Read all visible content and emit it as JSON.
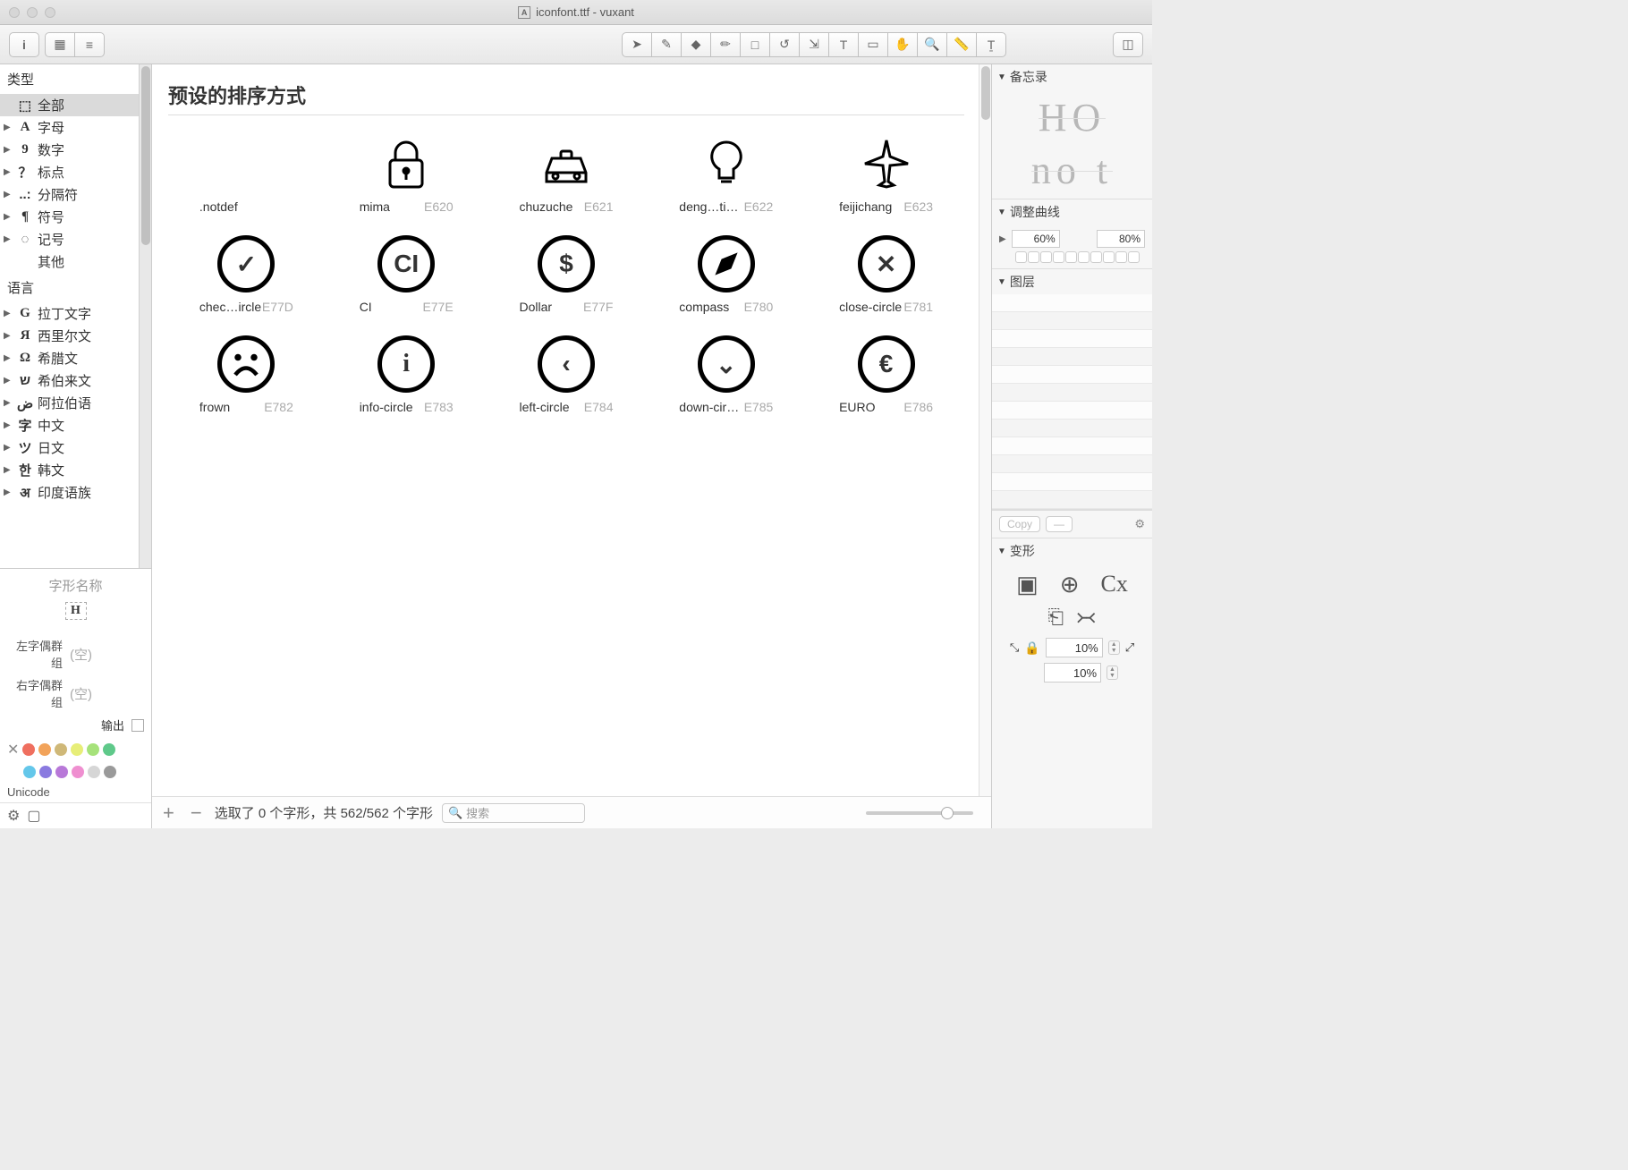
{
  "window": {
    "title": "iconfont.ttf - vuxant"
  },
  "sidebar": {
    "section_types": "类型",
    "types": [
      {
        "glyph": "⬚",
        "label": "全部",
        "selected": true,
        "arrow": false
      },
      {
        "glyph": "A",
        "label": "字母",
        "arrow": true,
        "serif": true
      },
      {
        "glyph": "9",
        "label": "数字",
        "arrow": true,
        "serif": true,
        "bold": true
      },
      {
        "glyph": "？",
        "label": "标点",
        "arrow": true
      },
      {
        "glyph": "..:",
        "label": "分隔符",
        "arrow": true
      },
      {
        "glyph": "¶",
        "label": "符号",
        "arrow": true,
        "serif": true
      },
      {
        "glyph": "◌",
        "label": "记号",
        "arrow": true
      },
      {
        "glyph": "",
        "label": "其他",
        "arrow": false
      }
    ],
    "section_lang": "语言",
    "langs": [
      {
        "glyph": "G",
        "label": "拉丁文字",
        "serif": true
      },
      {
        "glyph": "Я",
        "label": "西里尔文",
        "serif": true
      },
      {
        "glyph": "Ω",
        "label": "希腊文",
        "serif": true
      },
      {
        "glyph": "ש",
        "label": "希伯来文"
      },
      {
        "glyph": "ض",
        "label": "阿拉伯语"
      },
      {
        "glyph": "字",
        "label": "中文",
        "bold": true
      },
      {
        "glyph": "ツ",
        "label": "日文",
        "bold": true
      },
      {
        "glyph": "한",
        "label": "韩文",
        "bold": true
      },
      {
        "glyph": "अ",
        "label": "印度语族"
      }
    ],
    "glyph_name_label": "字形名称",
    "left_kern_label": "左字偶群组",
    "right_kern_label": "右字偶群组",
    "empty": "(空)",
    "output_label": "输出",
    "unicode_label": "Unicode",
    "colors_a": [
      "#ef6f5f",
      "#f2a35a",
      "#cfb878",
      "#e7ee78",
      "#a6e27a",
      "#5fc98a"
    ],
    "colors_b": [
      "#64c7ea",
      "#8a7ae0",
      "#b878d8",
      "#ef8fd0",
      "#d6d6d6",
      "#9a9a9a"
    ]
  },
  "main": {
    "heading": "预设的排序方式",
    "glyphs": [
      {
        "name": ".notdef",
        "code": "",
        "svg": "notdef"
      },
      {
        "name": "mima",
        "code": "E620",
        "svg": "lock"
      },
      {
        "name": "chuzuche",
        "code": "E621",
        "svg": "taxi"
      },
      {
        "name": "deng…tishi",
        "code": "E622",
        "svg": "bulb"
      },
      {
        "name": "feijichang",
        "code": "E623",
        "svg": "plane"
      },
      {
        "name": "chec…ircle",
        "code": "E77D",
        "svg": "check-circle"
      },
      {
        "name": "CI",
        "code": "E77E",
        "svg": "ci"
      },
      {
        "name": "Dollar",
        "code": "E77F",
        "svg": "dollar"
      },
      {
        "name": "compass",
        "code": "E780",
        "svg": "compass"
      },
      {
        "name": "close-circle",
        "code": "E781",
        "svg": "close"
      },
      {
        "name": "frown",
        "code": "E782",
        "svg": "frown"
      },
      {
        "name": "info-circle",
        "code": "E783",
        "svg": "info"
      },
      {
        "name": "left-circle",
        "code": "E784",
        "svg": "left"
      },
      {
        "name": "down-circle",
        "code": "E785",
        "svg": "down"
      },
      {
        "name": "EURO",
        "code": "E786",
        "svg": "euro"
      }
    ],
    "status_text": "选取了 0 个字形，共 562/562 个字形",
    "search_placeholder": "搜索"
  },
  "right": {
    "memo_label": "备忘录",
    "memo_top": "HO",
    "memo_bot": "no t",
    "curve_label": "调整曲线",
    "curve_a": "60%",
    "curve_b": "80%",
    "layers_label": "图层",
    "copy_label": "Copy",
    "transform_label": "变形",
    "t_val_a": "10%",
    "t_val_b": "10%"
  }
}
